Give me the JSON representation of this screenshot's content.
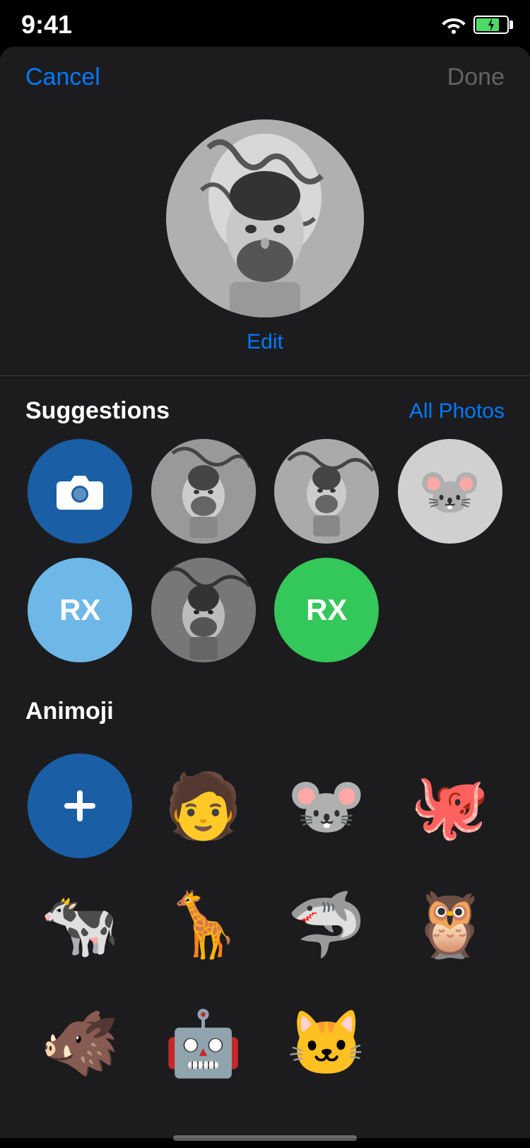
{
  "statusBar": {
    "time": "9:41"
  },
  "header": {
    "cancel_label": "Cancel",
    "done_label": "Done"
  },
  "avatar": {
    "edit_label": "Edit"
  },
  "suggestions": {
    "title": "Suggestions",
    "all_photos_label": "All Photos",
    "items": [
      {
        "type": "camera",
        "label": "camera"
      },
      {
        "type": "photo_bw1",
        "label": "photo 1"
      },
      {
        "type": "photo_bw2",
        "label": "photo 2"
      },
      {
        "type": "mouse_emoji",
        "label": "mouse"
      },
      {
        "type": "rx_light",
        "label": "RX",
        "text": "RX"
      },
      {
        "type": "photo_bw3",
        "label": "photo 3"
      },
      {
        "type": "rx_green",
        "label": "RX",
        "text": "RX"
      }
    ]
  },
  "animoji": {
    "title": "Animoji",
    "items_row1": [
      {
        "type": "add",
        "label": "add"
      },
      {
        "type": "emoji",
        "emoji": "🧑",
        "label": "person"
      },
      {
        "type": "emoji",
        "emoji": "🐭",
        "label": "mouse"
      },
      {
        "type": "emoji",
        "emoji": "🐙",
        "label": "octopus"
      }
    ],
    "items_row2": [
      {
        "type": "emoji",
        "emoji": "🐄",
        "label": "cow"
      },
      {
        "type": "emoji",
        "emoji": "🦒",
        "label": "giraffe"
      },
      {
        "type": "emoji",
        "emoji": "🦈",
        "label": "shark"
      },
      {
        "type": "emoji",
        "emoji": "🦉",
        "label": "owl"
      }
    ],
    "items_row3": [
      {
        "type": "emoji",
        "emoji": "🐗",
        "label": "boar"
      },
      {
        "type": "emoji",
        "emoji": "🤖",
        "label": "robot"
      },
      {
        "type": "emoji",
        "emoji": "🐱",
        "label": "cat"
      }
    ]
  }
}
